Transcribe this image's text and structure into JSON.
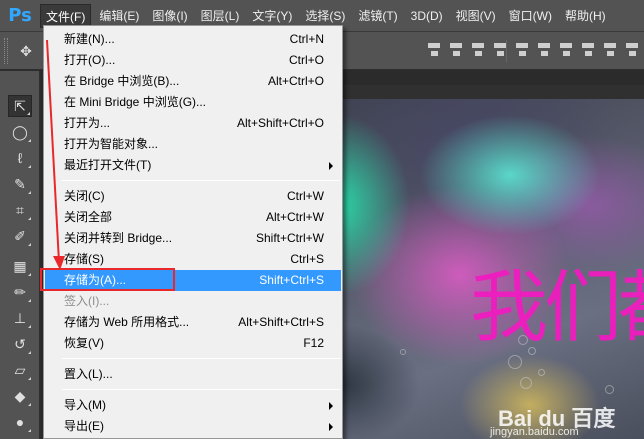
{
  "app": {
    "logo": "Ps"
  },
  "menubar": {
    "items": [
      "文件(F)",
      "编辑(E)",
      "图像(I)",
      "图层(L)",
      "文字(Y)",
      "选择(S)",
      "滤镜(T)",
      "3D(D)",
      "视图(V)",
      "窗口(W)",
      "帮助(H)"
    ],
    "active_index": 0
  },
  "options_bar": {
    "move_tool_icon": "move-icon"
  },
  "toolbar": {
    "tools": [
      "move",
      "elliptical-marquee",
      "lasso",
      "quick-selection",
      "crop",
      "eyedropper",
      "spot-healing-brush",
      "brush",
      "clone-stamp",
      "history-brush",
      "eraser",
      "paint-bucket",
      "blur"
    ],
    "selected": "move"
  },
  "file_menu": {
    "items": [
      {
        "label": "新建(N)...",
        "shortcut": "Ctrl+N"
      },
      {
        "label": "打开(O)...",
        "shortcut": "Ctrl+O"
      },
      {
        "label": "在 Bridge 中浏览(B)...",
        "shortcut": "Alt+Ctrl+O"
      },
      {
        "label": "在 Mini Bridge 中浏览(G)...",
        "shortcut": ""
      },
      {
        "label": "打开为...",
        "shortcut": "Alt+Shift+Ctrl+O"
      },
      {
        "label": "打开为智能对象...",
        "shortcut": ""
      },
      {
        "label": "最近打开文件(T)",
        "shortcut": "",
        "submenu": true
      },
      {
        "separator": true
      },
      {
        "label": "关闭(C)",
        "shortcut": "Ctrl+W"
      },
      {
        "label": "关闭全部",
        "shortcut": "Alt+Ctrl+W"
      },
      {
        "label": "关闭并转到 Bridge...",
        "shortcut": "Shift+Ctrl+W"
      },
      {
        "label": "存储(S)",
        "shortcut": "Ctrl+S"
      },
      {
        "label": "存储为(A)...",
        "shortcut": "Shift+Ctrl+S",
        "highlighted": true
      },
      {
        "label": "签入(I)...",
        "shortcut": "",
        "disabled": true
      },
      {
        "label": "存储为 Web 所用格式...",
        "shortcut": "Alt+Shift+Ctrl+S"
      },
      {
        "label": "恢复(V)",
        "shortcut": "F12"
      },
      {
        "separator": true
      },
      {
        "label": "置入(L)...",
        "shortcut": ""
      },
      {
        "separator": true
      },
      {
        "label": "导入(M)",
        "shortcut": "",
        "submenu": true
      },
      {
        "label": "导出(E)",
        "shortcut": "",
        "submenu": true
      }
    ]
  },
  "canvas": {
    "overlay_text": "我们都是",
    "watermark_brand": "Bai du 百度",
    "watermark_url": "jingyan.baidu.com"
  },
  "annotation": {
    "color": "#e8282a"
  }
}
